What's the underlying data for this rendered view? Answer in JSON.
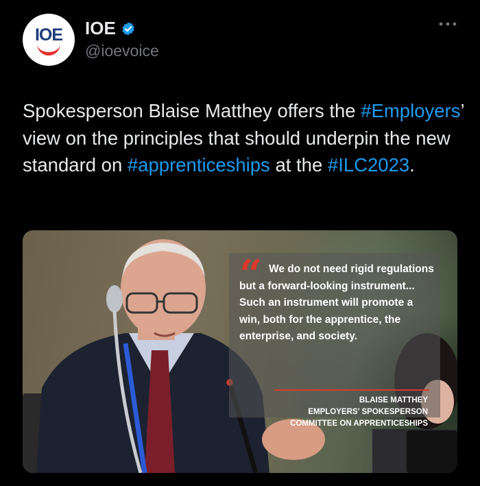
{
  "account": {
    "avatar_text": "IOE",
    "display_name": "IOE",
    "handle": "@ioevoice",
    "verified": true
  },
  "tweet": {
    "text_1": "Spokesperson Blaise Matthey offers the ",
    "hashtag_1": "#Employers",
    "text_2": "’ view on the principles that should underpin the new standard on ",
    "hashtag_2": "#apprenticeships",
    "text_3": " at the ",
    "hashtag_3": "#ILC2023",
    "text_4": "."
  },
  "media": {
    "quote_mark": "“",
    "quote_text": "We do not need rigid regulations but a forward-looking instrument... Such an instrument will promote a win, both for the apprentice, the enterprise, and society.",
    "attribution_name": "BLAISE MATTHEY",
    "attribution_role": "EMPLOYERS' SPOKESPERSON",
    "attribution_committee": "COMMITTEE ON APPRENTICESHIPS"
  },
  "colors": {
    "link": "#1d9bf0",
    "verified": "#1d9bf0",
    "quote_accent": "#d93a2b"
  },
  "icons": [
    "verified-badge-icon",
    "more-options-icon"
  ]
}
